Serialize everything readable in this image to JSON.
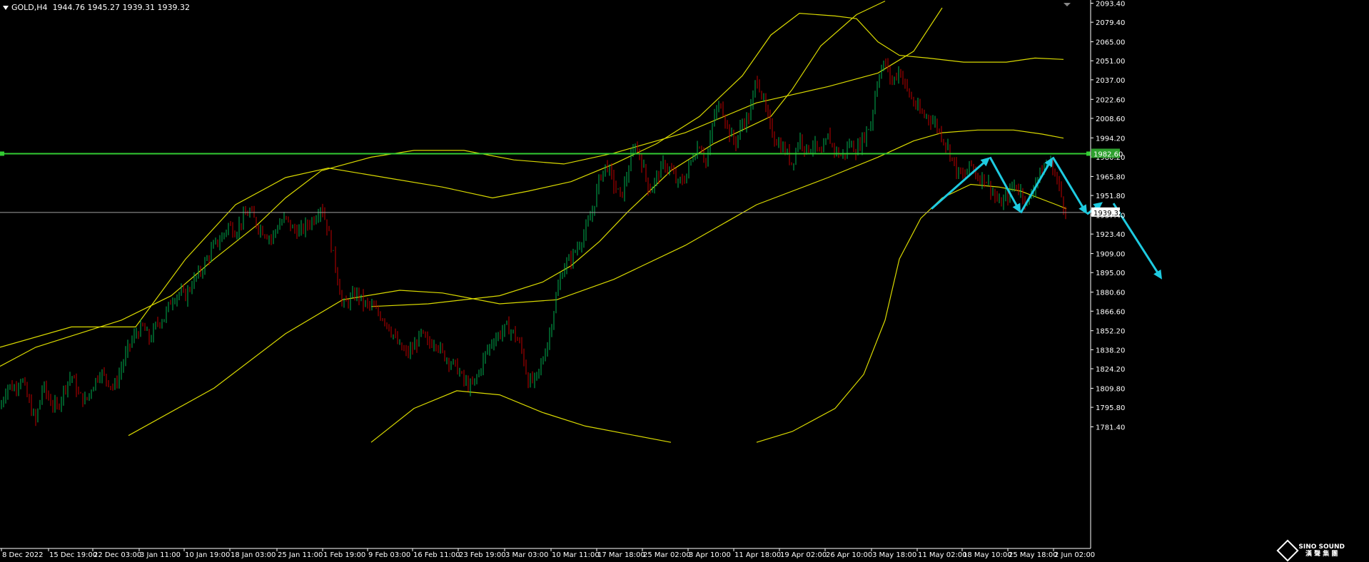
{
  "header": {
    "symbol": "GOLD,H4",
    "ohlc": "1944.76 1945.27 1939.31 1939.32"
  },
  "logo": {
    "line1": "SINO SOUND",
    "line2": "漢 聲 集 團"
  },
  "colors": {
    "background": "#000000",
    "bull_candle": "#00b050",
    "bear_candle": "#c00000",
    "bands": "#d9d900",
    "level_line": "#33cc33",
    "price_line": "#a0a0a0",
    "pattern_arrows": "#1ecbe1",
    "axis_text": "#ffffff"
  },
  "chart_data": {
    "type": "candlestick",
    "title": "GOLD,H4",
    "ylim": [
      1771.0,
      2098.0
    ],
    "y_ticks": [
      "2093.40",
      "2079.40",
      "2065.00",
      "2051.00",
      "2037.00",
      "2022.60",
      "2008.60",
      "1994.20",
      "1980.20",
      "1965.80",
      "1951.80",
      "1937.40",
      "1923.40",
      "1909.00",
      "1895.00",
      "1880.60",
      "1866.60",
      "1852.20",
      "1838.20",
      "1824.20",
      "1809.80",
      "1795.80",
      "1781.40"
    ],
    "x_ticks": [
      "8 Dec 2022",
      "15 Dec 19:00",
      "22 Dec 03:00",
      "3 Jan 11:00",
      "10 Jan 19:00",
      "18 Jan 03:00",
      "25 Jan 11:00",
      "1 Feb 19:00",
      "9 Feb 03:00",
      "16 Feb 11:00",
      "23 Feb 19:00",
      "3 Mar 03:00",
      "10 Mar 11:00",
      "17 Mar 18:00",
      "25 Mar 02:00",
      "3 Apr 10:00",
      "11 Apr 18:00",
      "19 Apr 02:00",
      "26 Apr 10:00",
      "3 May 18:00",
      "11 May 02:00",
      "18 May 10:00",
      "25 May 18:00",
      "2 Jun 02:00"
    ],
    "horizontal_level": {
      "value": 1982.6,
      "label": "1982.60"
    },
    "current_price": {
      "value": 1939.32,
      "label": "1939.32"
    },
    "price_path": [
      [
        0,
        1795
      ],
      [
        10,
        1812
      ],
      [
        20,
        1810
      ],
      [
        30,
        1818
      ],
      [
        40,
        1800
      ],
      [
        50,
        1785
      ],
      [
        60,
        1812
      ],
      [
        70,
        1800
      ],
      [
        80,
        1795
      ],
      [
        90,
        1810
      ],
      [
        100,
        1820
      ],
      [
        110,
        1805
      ],
      [
        120,
        1800
      ],
      [
        130,
        1812
      ],
      [
        140,
        1822
      ],
      [
        150,
        1816
      ],
      [
        160,
        1810
      ],
      [
        170,
        1825
      ],
      [
        180,
        1840
      ],
      [
        190,
        1850
      ],
      [
        200,
        1855
      ],
      [
        210,
        1845
      ],
      [
        220,
        1858
      ],
      [
        230,
        1862
      ],
      [
        240,
        1875
      ],
      [
        250,
        1880
      ],
      [
        260,
        1878
      ],
      [
        270,
        1888
      ],
      [
        280,
        1895
      ],
      [
        290,
        1905
      ],
      [
        300,
        1915
      ],
      [
        310,
        1920
      ],
      [
        320,
        1930
      ],
      [
        330,
        1925
      ],
      [
        340,
        1935
      ],
      [
        350,
        1940
      ],
      [
        360,
        1930
      ],
      [
        370,
        1925
      ],
      [
        380,
        1920
      ],
      [
        390,
        1930
      ],
      [
        400,
        1935
      ],
      [
        410,
        1927
      ],
      [
        420,
        1925
      ],
      [
        430,
        1930
      ],
      [
        440,
        1935
      ],
      [
        450,
        1945
      ],
      [
        460,
        1925
      ],
      [
        470,
        1900
      ],
      [
        480,
        1870
      ],
      [
        490,
        1875
      ],
      [
        500,
        1880
      ],
      [
        510,
        1872
      ],
      [
        520,
        1870
      ],
      [
        530,
        1865
      ],
      [
        540,
        1860
      ],
      [
        550,
        1850
      ],
      [
        560,
        1840
      ],
      [
        570,
        1835
      ],
      [
        580,
        1840
      ],
      [
        590,
        1850
      ],
      [
        600,
        1842
      ],
      [
        610,
        1845
      ],
      [
        620,
        1835
      ],
      [
        630,
        1830
      ],
      [
        640,
        1825
      ],
      [
        650,
        1815
      ],
      [
        660,
        1810
      ],
      [
        670,
        1820
      ],
      [
        680,
        1835
      ],
      [
        690,
        1845
      ],
      [
        700,
        1850
      ],
      [
        710,
        1855
      ],
      [
        720,
        1850
      ],
      [
        730,
        1840
      ],
      [
        740,
        1815
      ],
      [
        750,
        1815
      ],
      [
        760,
        1830
      ],
      [
        770,
        1850
      ],
      [
        780,
        1880
      ],
      [
        790,
        1900
      ],
      [
        800,
        1905
      ],
      [
        810,
        1915
      ],
      [
        820,
        1925
      ],
      [
        830,
        1940
      ],
      [
        840,
        1965
      ],
      [
        850,
        1975
      ],
      [
        860,
        1960
      ],
      [
        870,
        1950
      ],
      [
        880,
        1970
      ],
      [
        890,
        1990
      ],
      [
        900,
        1975
      ],
      [
        910,
        1955
      ],
      [
        920,
        1965
      ],
      [
        930,
        1975
      ],
      [
        940,
        1970
      ],
      [
        950,
        1960
      ],
      [
        960,
        1965
      ],
      [
        970,
        1980
      ],
      [
        980,
        1990
      ],
      [
        990,
        1975
      ],
      [
        1000,
        2010
      ],
      [
        1010,
        2020
      ],
      [
        1020,
        2000
      ],
      [
        1030,
        1990
      ],
      [
        1040,
        2005
      ],
      [
        1050,
        2010
      ],
      [
        1060,
        2040
      ],
      [
        1070,
        2020
      ],
      [
        1080,
        2000
      ],
      [
        1090,
        1990
      ],
      [
        1100,
        1985
      ],
      [
        1110,
        1975
      ],
      [
        1120,
        1995
      ],
      [
        1130,
        1985
      ],
      [
        1140,
        1990
      ],
      [
        1150,
        1980
      ],
      [
        1160,
        1995
      ],
      [
        1170,
        1985
      ],
      [
        1180,
        1980
      ],
      [
        1190,
        1990
      ],
      [
        1200,
        1985
      ],
      [
        1210,
        1995
      ],
      [
        1220,
        2005
      ],
      [
        1230,
        2040
      ],
      [
        1240,
        2050
      ],
      [
        1250,
        2035
      ],
      [
        1260,
        2045
      ],
      [
        1270,
        2030
      ],
      [
        1280,
        2020
      ],
      [
        1290,
        2012
      ],
      [
        1300,
        2010
      ],
      [
        1310,
        2005
      ],
      [
        1320,
        1995
      ],
      [
        1330,
        1985
      ],
      [
        1340,
        1970
      ],
      [
        1350,
        1965
      ],
      [
        1360,
        1975
      ],
      [
        1370,
        1965
      ],
      [
        1380,
        1965
      ],
      [
        1390,
        1955
      ],
      [
        1400,
        1945
      ],
      [
        1410,
        1950
      ],
      [
        1420,
        1960
      ],
      [
        1430,
        1955
      ],
      [
        1440,
        1945
      ],
      [
        1450,
        1962
      ],
      [
        1460,
        1970
      ],
      [
        1470,
        1978
      ],
      [
        1480,
        1965
      ],
      [
        1490,
        1945
      ],
      [
        1494,
        1939.32
      ]
    ],
    "bollinger_wide": {
      "upper": [
        [
          0,
          1840
        ],
        [
          100,
          1855
        ],
        [
          190,
          1855
        ],
        [
          260,
          1905
        ],
        [
          330,
          1945
        ],
        [
          400,
          1965
        ],
        [
          460,
          1972
        ],
        [
          540,
          1965
        ],
        [
          620,
          1958
        ],
        [
          690,
          1950
        ],
        [
          740,
          1955
        ],
        [
          800,
          1962
        ],
        [
          860,
          1975
        ],
        [
          920,
          1990
        ],
        [
          980,
          2010
        ],
        [
          1040,
          2040
        ],
        [
          1080,
          2070
        ],
        [
          1120,
          2086
        ],
        [
          1170,
          2084
        ],
        [
          1200,
          2082
        ],
        [
          1230,
          2065
        ],
        [
          1260,
          2055
        ],
        [
          1300,
          2053
        ],
        [
          1350,
          2050
        ],
        [
          1410,
          2050
        ],
        [
          1450,
          2053
        ],
        [
          1490,
          2052
        ]
      ],
      "middle": [
        [
          180,
          1775
        ],
        [
          300,
          1810
        ],
        [
          400,
          1850
        ],
        [
          480,
          1875
        ],
        [
          560,
          1882
        ],
        [
          620,
          1880
        ],
        [
          700,
          1872
        ],
        [
          780,
          1875
        ],
        [
          860,
          1890
        ],
        [
          960,
          1915
        ],
        [
          1060,
          1945
        ],
        [
          1160,
          1965
        ],
        [
          1230,
          1980
        ],
        [
          1280,
          1992
        ],
        [
          1320,
          1998
        ],
        [
          1370,
          2000
        ],
        [
          1420,
          2000
        ],
        [
          1460,
          1997
        ],
        [
          1490,
          1994
        ]
      ],
      "lower": [
        [
          520,
          1770
        ],
        [
          580,
          1795
        ],
        [
          640,
          1808
        ],
        [
          700,
          1805
        ],
        [
          760,
          1792
        ],
        [
          820,
          1782
        ],
        [
          880,
          1776
        ],
        [
          940,
          1770
        ]
      ]
    },
    "bollinger_tight": {
      "lower": [
        [
          0,
          1826
        ],
        [
          50,
          1840
        ],
        [
          110,
          1850
        ],
        [
          170,
          1860
        ],
        [
          240,
          1878
        ],
        [
          300,
          1905
        ],
        [
          360,
          1930
        ],
        [
          400,
          1950
        ],
        [
          450,
          1970
        ],
        [
          520,
          1980
        ],
        [
          580,
          1985
        ],
        [
          650,
          1985
        ],
        [
          720,
          1978
        ],
        [
          790,
          1975
        ],
        [
          860,
          1983
        ],
        [
          960,
          1998
        ],
        [
          1060,
          2020
        ],
        [
          1160,
          2032
        ],
        [
          1230,
          2042
        ],
        [
          1280,
          2058
        ],
        [
          1320,
          2090
        ]
      ],
      "upper": [
        [
          520,
          1870
        ],
        [
          600,
          1872
        ],
        [
          700,
          1878
        ],
        [
          760,
          1888
        ],
        [
          800,
          1900
        ],
        [
          840,
          1918
        ],
        [
          880,
          1940
        ],
        [
          940,
          1970
        ],
        [
          970,
          1980
        ],
        [
          1000,
          1990
        ],
        [
          1040,
          2000
        ],
        [
          1080,
          2010
        ],
        [
          1110,
          2030
        ],
        [
          1150,
          2062
        ],
        [
          1200,
          2085
        ],
        [
          1240,
          2095
        ]
      ],
      "bottom_band": [
        [
          1060,
          1770
        ],
        [
          1110,
          1778
        ],
        [
          1170,
          1795
        ],
        [
          1210,
          1820
        ],
        [
          1240,
          1860
        ],
        [
          1260,
          1905
        ],
        [
          1290,
          1935
        ],
        [
          1320,
          1950
        ],
        [
          1360,
          1960
        ],
        [
          1400,
          1958
        ],
        [
          1430,
          1955
        ],
        [
          1480,
          1945
        ],
        [
          1494,
          1942
        ]
      ]
    },
    "pattern_arrows": [
      {
        "from": [
          1305,
          1942
        ],
        "to": [
          1387,
          1980
        ]
      },
      {
        "from": [
          1387,
          1980
        ],
        "to": [
          1430,
          1939
        ]
      },
      {
        "from": [
          1430,
          1939
        ],
        "to": [
          1475,
          1980
        ]
      },
      {
        "from": [
          1475,
          1980
        ],
        "to": [
          1523,
          1938
        ]
      },
      {
        "from": [
          1523,
          1938
        ],
        "to": [
          1545,
          1947
        ]
      },
      {
        "from": [
          1560,
          1946
        ],
        "to": [
          1628,
          1890
        ]
      }
    ]
  }
}
